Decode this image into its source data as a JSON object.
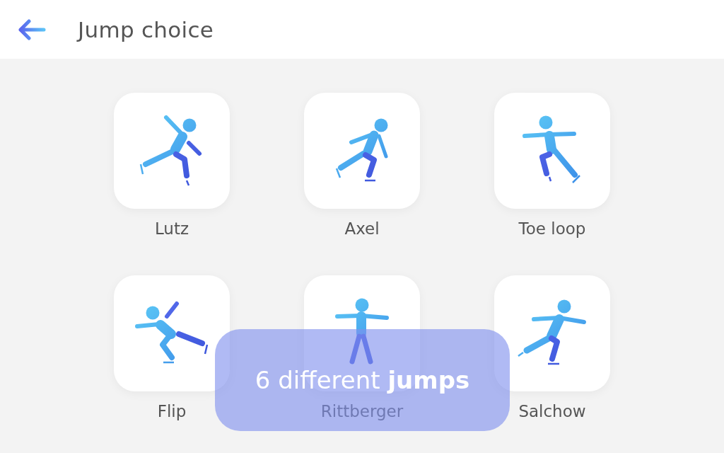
{
  "header": {
    "title": "Jump choice"
  },
  "jumps": [
    {
      "label": "Lutz"
    },
    {
      "label": "Axel"
    },
    {
      "label": "Toe loop"
    },
    {
      "label": "Flip"
    },
    {
      "label": "Rittberger"
    },
    {
      "label": "Salchow"
    }
  ],
  "toast": {
    "text": "6 different **jumps**"
  }
}
